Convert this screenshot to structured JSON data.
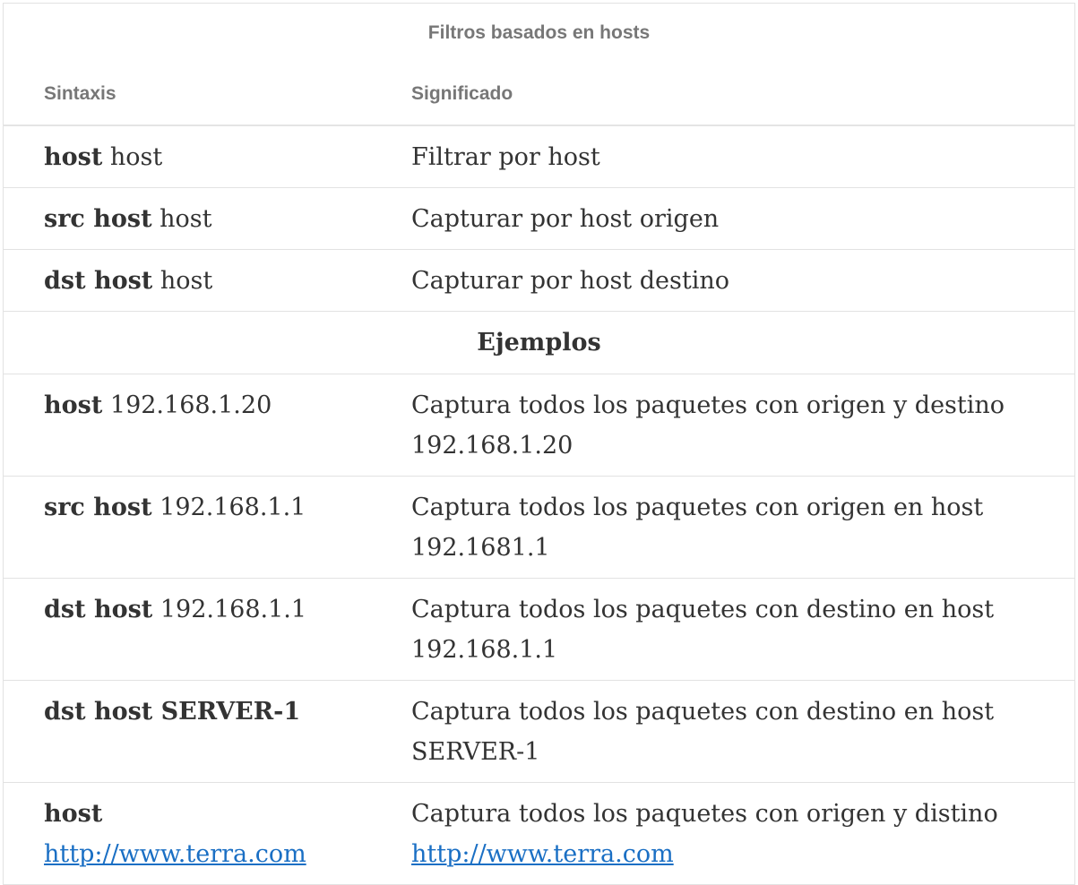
{
  "caption": "Filtros basados en hosts",
  "headers": {
    "syntax": "Sintaxis",
    "meaning": "Significado"
  },
  "rows": [
    {
      "keyword": "host",
      "arg": " host",
      "meaning": "Filtrar por host"
    },
    {
      "keyword": "src host",
      "arg": " host",
      "meaning": "Capturar por host origen"
    },
    {
      "keyword": "dst host",
      "arg": " host",
      "meaning": "Capturar por host destino"
    }
  ],
  "section_title": "Ejemplos",
  "examples": [
    {
      "keyword": "host",
      "arg": " 192.168.1.20",
      "meaning": "Captura todos los paquetes con origen y destino 192.168.1.20"
    },
    {
      "keyword": "src host",
      "arg": " 192.168.1.1",
      "meaning": "Captura todos los paquetes con origen en host 192.1681.1"
    },
    {
      "keyword": "dst host",
      "arg": " 192.168.1.1",
      "meaning": "Captura todos los paquetes con destino en host 192.168.1.1"
    },
    {
      "keyword": "dst host SERVER-1",
      "arg": "",
      "meaning": "Captura todos los paquetes con destino en host SERVER-1"
    }
  ],
  "last_example": {
    "keyword": "host",
    "link": "http://www.terra.com",
    "meaning_text": "Captura todos los paquetes con origen y distino",
    "meaning_link": "http://www.terra.com"
  },
  "colors": {
    "text": "#333333",
    "header_text": "#777777",
    "link": "#1a6fc4",
    "border": "#e2e2e2"
  }
}
